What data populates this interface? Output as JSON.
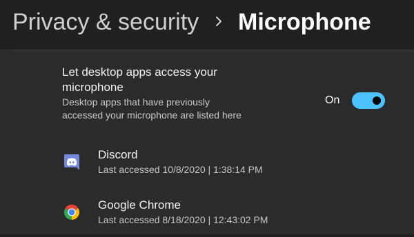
{
  "header": {
    "breadcrumb_parent": "Privacy & security",
    "breadcrumb_separator_icon": "chevron-right-icon",
    "page_title": "Microphone"
  },
  "desktop_access": {
    "title": "Let desktop apps access your microphone",
    "description": "Desktop apps that have previously accessed your microphone are listed here",
    "toggle_label": "On",
    "toggle_state": true,
    "accent_color": "#4cc2ff"
  },
  "apps": [
    {
      "name": "Discord",
      "icon": "discord-icon",
      "last_accessed": "Last accessed 10/8/2020  |  1:38:14 PM"
    },
    {
      "name": "Google Chrome",
      "icon": "chrome-icon",
      "last_accessed": "Last accessed 8/18/2020  |  12:43:02 PM"
    }
  ]
}
